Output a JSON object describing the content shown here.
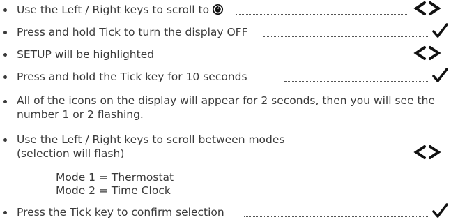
{
  "steps": [
    {
      "text": "Use the Left / Right keys to scroll to",
      "icon": "power-icon",
      "action": "left-right-arrows-icon"
    },
    {
      "text": "Press and hold Tick to turn the display OFF",
      "action": "tick-icon"
    },
    {
      "text": "SETUP will be highlighted",
      "action": "left-right-arrows-icon"
    },
    {
      "text": "Press and hold the Tick key for 10 seconds",
      "action": "tick-icon"
    },
    {
      "text": "All of the icons on the display will appear for 2 seconds, then you will see the number 1 or 2 flashing.",
      "action": null
    },
    {
      "text_line1": "Use the Left / Right keys to scroll between modes",
      "text_line2": "(selection will flash)",
      "action": "left-right-arrows-icon"
    },
    {
      "text": "Press the Tick key to confirm selection",
      "action": "tick-icon"
    }
  ],
  "modes": [
    "Mode 1 = Thermostat",
    "Mode 2 = Time Clock"
  ],
  "colors": {
    "text": "#3a3a3a",
    "icon": "#111111"
  }
}
